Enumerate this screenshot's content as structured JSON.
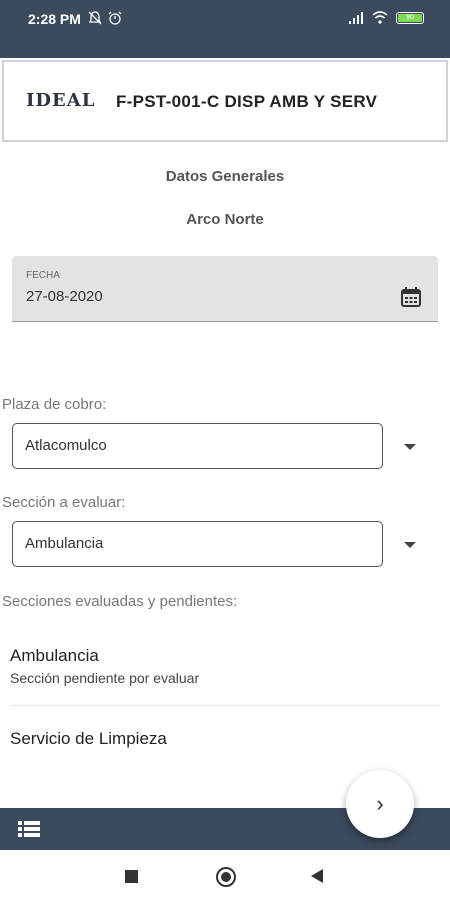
{
  "status_bar": {
    "time": "2:28 PM",
    "battery_label": "90",
    "left_icons": [
      "bell-off-icon",
      "alarm-icon"
    ],
    "right_icons": [
      "signal-icon",
      "wifi-icon",
      "battery-icon"
    ]
  },
  "header": {
    "logo_text": "IDEAL",
    "title": "F-PST-001-C DISP AMB Y SERV"
  },
  "section": {
    "heading": "Datos Generales",
    "subheading": "Arco Norte"
  },
  "date_field": {
    "label": "FECHA",
    "value": "27-08-2020"
  },
  "plaza": {
    "label": "Plaza de cobro:",
    "selected": "Atlacomulco"
  },
  "seccion": {
    "label": "Sección a evaluar:",
    "selected": "Ambulancia"
  },
  "sections_list": {
    "label": "Secciones evaluadas y pendientes:",
    "items": [
      {
        "title": "Ambulancia",
        "subtitle": "Sección pendiente por evaluar"
      },
      {
        "title": "Servicio de Limpieza",
        "subtitle": ""
      }
    ]
  },
  "fab": {
    "glyph": "›"
  },
  "colors": {
    "bar": "#3b4a5c",
    "field_bg": "#e3e3e3"
  }
}
